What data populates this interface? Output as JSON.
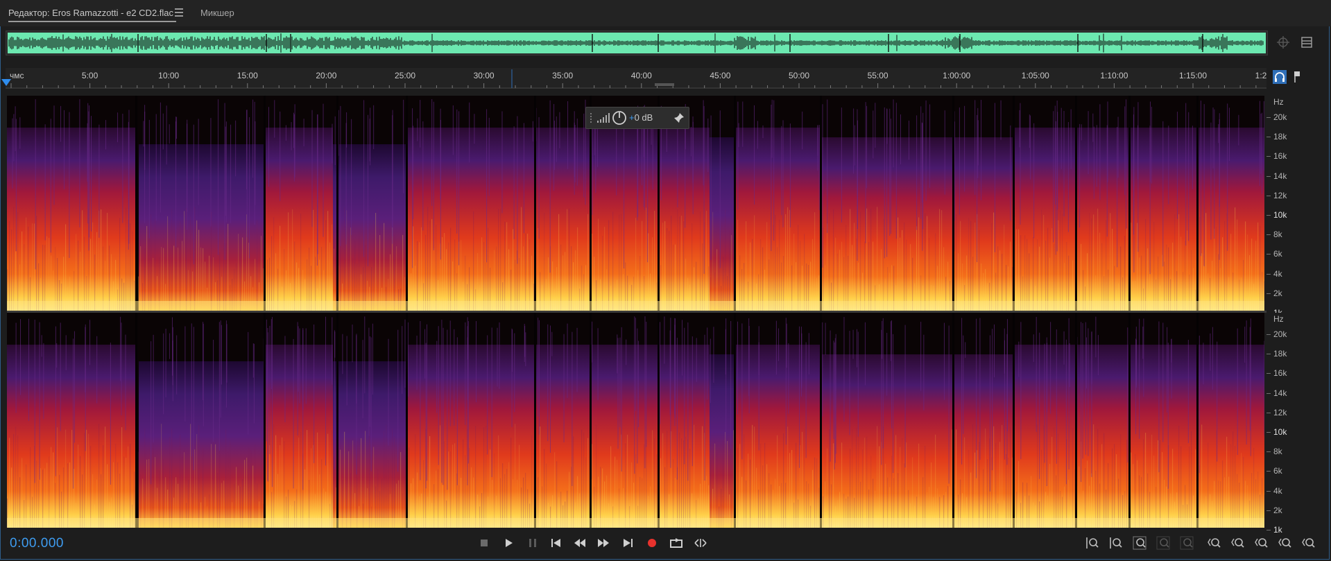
{
  "tabs": {
    "editor_label": "Редактор: Eros Ramazzotti - e2 CD2.flac",
    "mixer_label": "Микшер"
  },
  "ruler": {
    "unit_label": "чмс",
    "ticks": [
      "5:00",
      "10:00",
      "15:00",
      "20:00",
      "25:00",
      "30:00",
      "35:00",
      "40:00",
      "45:00",
      "50:00",
      "55:00",
      "1:00:00",
      "1:05:00",
      "1:10:00",
      "1:15:00",
      "1:2"
    ]
  },
  "spectral_hud": {
    "gain_label": "+0 dB"
  },
  "hz_scale": {
    "unit": "Hz",
    "labels": [
      "20k",
      "18k",
      "16k",
      "14k",
      "12k",
      "10k",
      "8k",
      "6k",
      "4k",
      "2k",
      "1k"
    ]
  },
  "transport": {
    "timecode": "0:00.000",
    "buttons": [
      "stop-icon",
      "play-icon",
      "pause-icon",
      "skip-start-icon",
      "rewind-icon",
      "fast-forward-icon",
      "skip-end-icon",
      "record-icon",
      "loop-icon",
      "skip-selection-icon"
    ],
    "record_color": "#e8322d"
  },
  "zoom_tools": [
    "zoom-in-amplitude-icon",
    "zoom-out-amplitude-icon",
    "zoom-in-frequency-icon",
    "zoom-out-frequency-icon",
    "zoom-to-selection-icon",
    "zoom-out-full-icon",
    "zoom-out-time-icon",
    "zoom-in-time-icon",
    "zoom-out-full-time-icon",
    "zoom-reset-icon",
    "zoom-region-icon"
  ],
  "colors": {
    "accent": "#3e9cf0",
    "waveform_bg": "#6ce8b0",
    "waveform_fg": "#1a2a22"
  }
}
